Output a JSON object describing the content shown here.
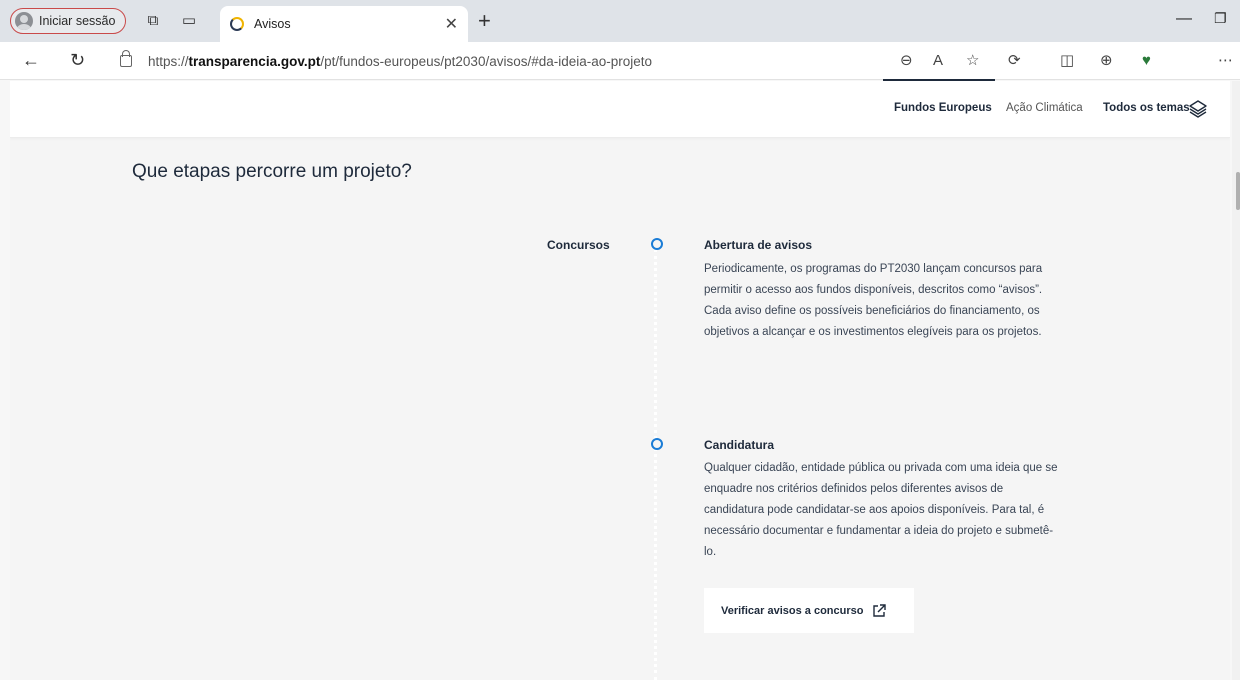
{
  "browser": {
    "profile_label": "Iniciar sessão",
    "tab_title": "Avisos",
    "url_prefix": "https://",
    "url_host": "transparencia.gov.pt",
    "url_path": "/pt/fundos-europeus/pt2030/avisos/#da-ideia-ao-projeto"
  },
  "header": {
    "nav": [
      {
        "label": "Fundos Europeus",
        "active": true
      },
      {
        "label": "Ação Climática",
        "active": false
      },
      {
        "label": "Todos os temas",
        "active": false
      }
    ]
  },
  "main": {
    "section_title": "Que etapas percorre um projeto?",
    "stage_label": "Concursos",
    "steps": [
      {
        "title": "Abertura de avisos",
        "lines": [
          "Periodicamente, os programas do PT2030 lançam concursos para",
          "permitir o acesso aos fundos disponíveis, descritos como “avisos”.",
          "Cada aviso define os possíveis beneficiários do financiamento, os",
          "objetivos a alcançar e os investimentos elegíveis para os projetos."
        ]
      },
      {
        "title": "Candidatura",
        "lines": [
          "Qualquer cidadão, entidade pública ou privada com uma ideia que se",
          "enquadre nos critérios definidos pelos diferentes avisos de",
          "candidatura pode candidatar-se aos apoios disponíveis. Para tal, é",
          "necessário documentar e fundamentar a ideia do projeto e submetê-",
          "lo."
        ]
      }
    ],
    "cta_label": "Verificar avisos a concurso"
  },
  "colors": {
    "accent_dot": "#1a7cd6",
    "text_dark": "#1e2a3b",
    "profile_border": "#c94a4a"
  }
}
